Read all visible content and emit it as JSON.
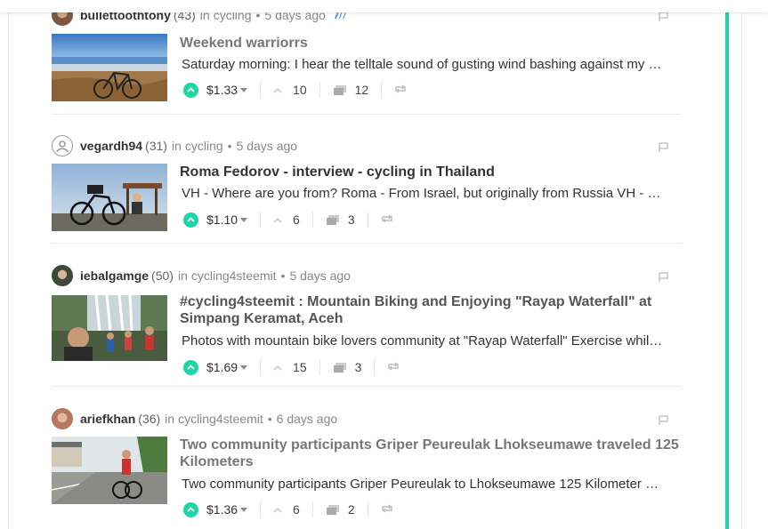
{
  "colors": {
    "accent": "#1fd4a6",
    "text": "#333333",
    "muted": "#888888"
  },
  "posts": [
    {
      "author": "bullettoothtony",
      "rep": "(43)",
      "in": "in",
      "community": "cycling",
      "bullet": "•",
      "age": "5 days ago",
      "title": "Weekend warriorrs",
      "excerpt": "Saturday morning: I hear the telltale sound of gusting wind bashing against my …",
      "payout": "$1.33",
      "votes": "10",
      "comments": "12",
      "thumb_desc": "mountain bike overlooking coastal city",
      "title_visited": true
    },
    {
      "author": "vegardh94",
      "rep": "(31)",
      "in": "in",
      "community": "cycling",
      "bullet": "•",
      "age": "5 days ago",
      "title": "Roma Fedorov - interview - cycling in Thailand",
      "excerpt": "VH - Where are you from? Roma - From Israel, but originally from Russia VH - …",
      "payout": "$1.10",
      "votes": "6",
      "comments": "3",
      "thumb_desc": "touring bike and rider by a sign",
      "title_visited": false
    },
    {
      "author": "iebalgamge",
      "rep": "(50)",
      "in": "in",
      "community": "cycling4steemit",
      "bullet": "•",
      "age": "5 days ago",
      "title": "#cycling4steemit : Mountain Biking and Enjoying \"Rayap Waterfall\" at Simpang Keramat, Aceh",
      "excerpt": "Photos with mountain bike lovers community at \"Rayap Waterfall\" Exercise whil…",
      "payout": "$1.69",
      "votes": "15",
      "comments": "3",
      "thumb_desc": "group selfie at waterfall",
      "title_visited": true
    },
    {
      "author": "ariefkhan",
      "rep": "(36)",
      "in": "in",
      "community": "cycling4steemit",
      "bullet": "•",
      "age": "6 days ago",
      "title": "Two community participants Griper Peureulak Lhokseumawe traveled 125 Kilometers",
      "excerpt": "Two community participants Griper Peureulak to Lhokseumawe 125 Kilometer …",
      "payout": "$1.36",
      "votes": "6",
      "comments": "2",
      "thumb_desc": "cyclist on rural road",
      "title_visited": true
    }
  ]
}
